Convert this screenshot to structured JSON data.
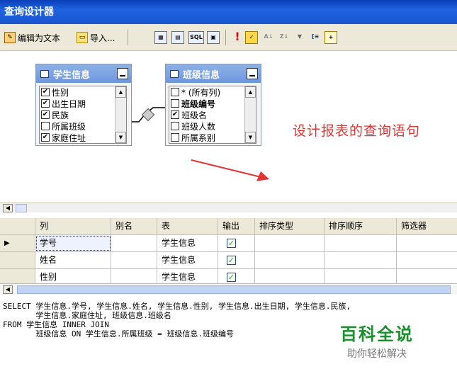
{
  "window": {
    "title": "查询设计器"
  },
  "toolbar": {
    "edit_as_text": "编辑为文本",
    "import": "导入...",
    "icons": [
      "diagram-icon",
      "grid-icon",
      "sql-icon",
      "result-icon",
      "run-icon",
      "verify-icon",
      "sort-asc-icon",
      "sort-desc-icon",
      "filter-icon",
      "group-by-icon",
      "add-table-icon"
    ],
    "sql_icon_text": "SQL",
    "run_icon_text": "!"
  },
  "diagram": {
    "tables": [
      {
        "name": "学生信息",
        "fields": [
          {
            "label": "性别",
            "checked": true
          },
          {
            "label": "出生日期",
            "checked": true
          },
          {
            "label": "民族",
            "checked": true
          },
          {
            "label": "所属班级",
            "checked": false
          },
          {
            "label": "家庭住址",
            "checked": true
          }
        ]
      },
      {
        "name": "班级信息",
        "fields": [
          {
            "label": "* (所有列)",
            "checked": false
          },
          {
            "label": "班级编号",
            "checked": false
          },
          {
            "label": "班级名",
            "checked": true
          },
          {
            "label": "班级人数",
            "checked": false
          },
          {
            "label": "所属系别",
            "checked": false
          }
        ]
      }
    ],
    "annotation": "设计报表的查询语句"
  },
  "grid": {
    "columns": [
      "列",
      "别名",
      "表",
      "输出",
      "排序类型",
      "排序顺序",
      "筛选器"
    ],
    "rows": [
      {
        "column": "学号",
        "alias": "",
        "table": "学生信息",
        "output": true
      },
      {
        "column": "姓名",
        "alias": "",
        "table": "学生信息",
        "output": true
      },
      {
        "column": "性别",
        "alias": "",
        "table": "学生信息",
        "output": true
      }
    ]
  },
  "sql": {
    "lines": [
      "SELECT 学生信息.学号, 学生信息.姓名, 学生信息.性别, 学生信息.出生日期, 学生信息.民族,",
      "       学生信息.家庭住址, 班级信息.班级名",
      "FROM 学生信息 INNER JOIN",
      "       班级信息 ON 学生信息.所属班级 = 班级信息.班级编号"
    ]
  },
  "watermark": {
    "title": "百科全说",
    "subtitle": "助你轻松解决"
  },
  "colors": {
    "titlebar": "#1f62e0",
    "annotation": "#e23434",
    "watermark": "#1b8f2c"
  }
}
